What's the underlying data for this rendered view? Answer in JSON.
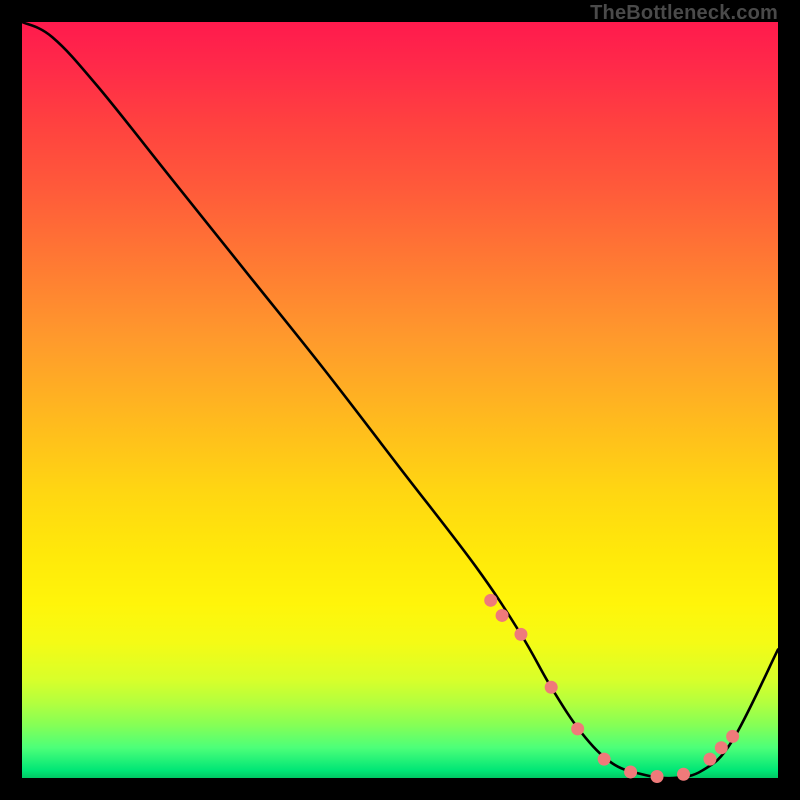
{
  "attribution": "TheBottleneck.com",
  "chart_data": {
    "type": "line",
    "title": "",
    "xlabel": "",
    "ylabel": "",
    "xlim": [
      0,
      100
    ],
    "ylim": [
      0,
      100
    ],
    "grid": false,
    "legend": false,
    "series": [
      {
        "name": "curve",
        "color": "#000000",
        "x": [
          0,
          4,
          10,
          20,
          30,
          40,
          50,
          60,
          66,
          70,
          74,
          78,
          82,
          86,
          90,
          94,
          100
        ],
        "values": [
          100,
          98,
          91.5,
          79,
          66.5,
          54,
          41,
          28,
          19,
          12,
          6,
          2,
          0.5,
          0,
          1,
          5,
          17
        ]
      }
    ],
    "markers": {
      "name": "floor-dots",
      "color": "#ef7a7a",
      "radius_px": 6.5,
      "x": [
        62,
        63.5,
        66,
        70,
        73.5,
        77,
        80.5,
        84,
        87.5,
        91,
        92.5,
        94
      ],
      "values": [
        23.5,
        21.5,
        19,
        12,
        6.5,
        2.5,
        0.8,
        0.2,
        0.5,
        2.5,
        4,
        5.5
      ]
    }
  }
}
